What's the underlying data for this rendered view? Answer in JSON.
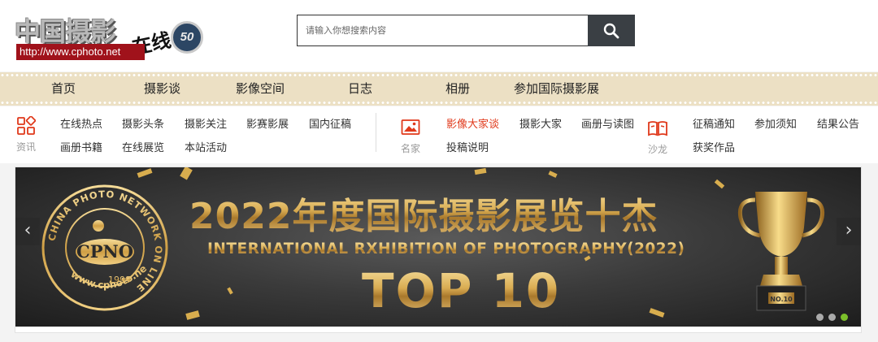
{
  "logo": {
    "text": "中国摄影",
    "zai": "在线",
    "url": "http://www.cphoto.net",
    "badge": "50"
  },
  "search": {
    "placeholder": "请输入你想搜索内容",
    "button_icon": "search-icon"
  },
  "nav": {
    "items": [
      {
        "label": "首页"
      },
      {
        "label": "摄影谈"
      },
      {
        "label": "影像空间"
      },
      {
        "label": "日志"
      },
      {
        "label": "相册"
      },
      {
        "label": "参加国际摄影展"
      }
    ]
  },
  "subnav": {
    "groups": [
      {
        "label": "资讯",
        "icon": "grid-icon",
        "links": [
          "在线热点",
          "摄影头条",
          "摄影关注",
          "影赛影展",
          "国内征稿",
          "画册书籍",
          "在线展览",
          "本站活动"
        ]
      },
      {
        "label": "名家",
        "icon": "image-icon",
        "links": [
          "影像大家谈",
          "摄影大家",
          "画册与读图",
          "投稿说明"
        ]
      },
      {
        "label": "沙龙",
        "icon": "book-icon",
        "links": [
          "征稿通知",
          "参加须知",
          "结果公告",
          "获奖作品"
        ]
      }
    ],
    "active_color": "#e0391b"
  },
  "banner": {
    "title": "2022年度国际摄影展览十杰",
    "subtitle": "INTERNATIONAL RXHIBITION OF PHOTOGRAPHY(2022)",
    "top": "TOP 10",
    "seal_ring": "CHINA PHOTO NETWORK ON LINE",
    "seal_center": "CPNO",
    "seal_year": "1999",
    "seal_url": "www.cphoto.net",
    "trophy_label": "NO.10",
    "prev_label": "‹",
    "next_label": "›",
    "active_slide": 3,
    "slide_count": 3
  },
  "colors": {
    "nav_bg": "#ece0c4",
    "gold": "#d9ac52",
    "dark": "#3a3f44",
    "accent": "#7bbf2a"
  }
}
